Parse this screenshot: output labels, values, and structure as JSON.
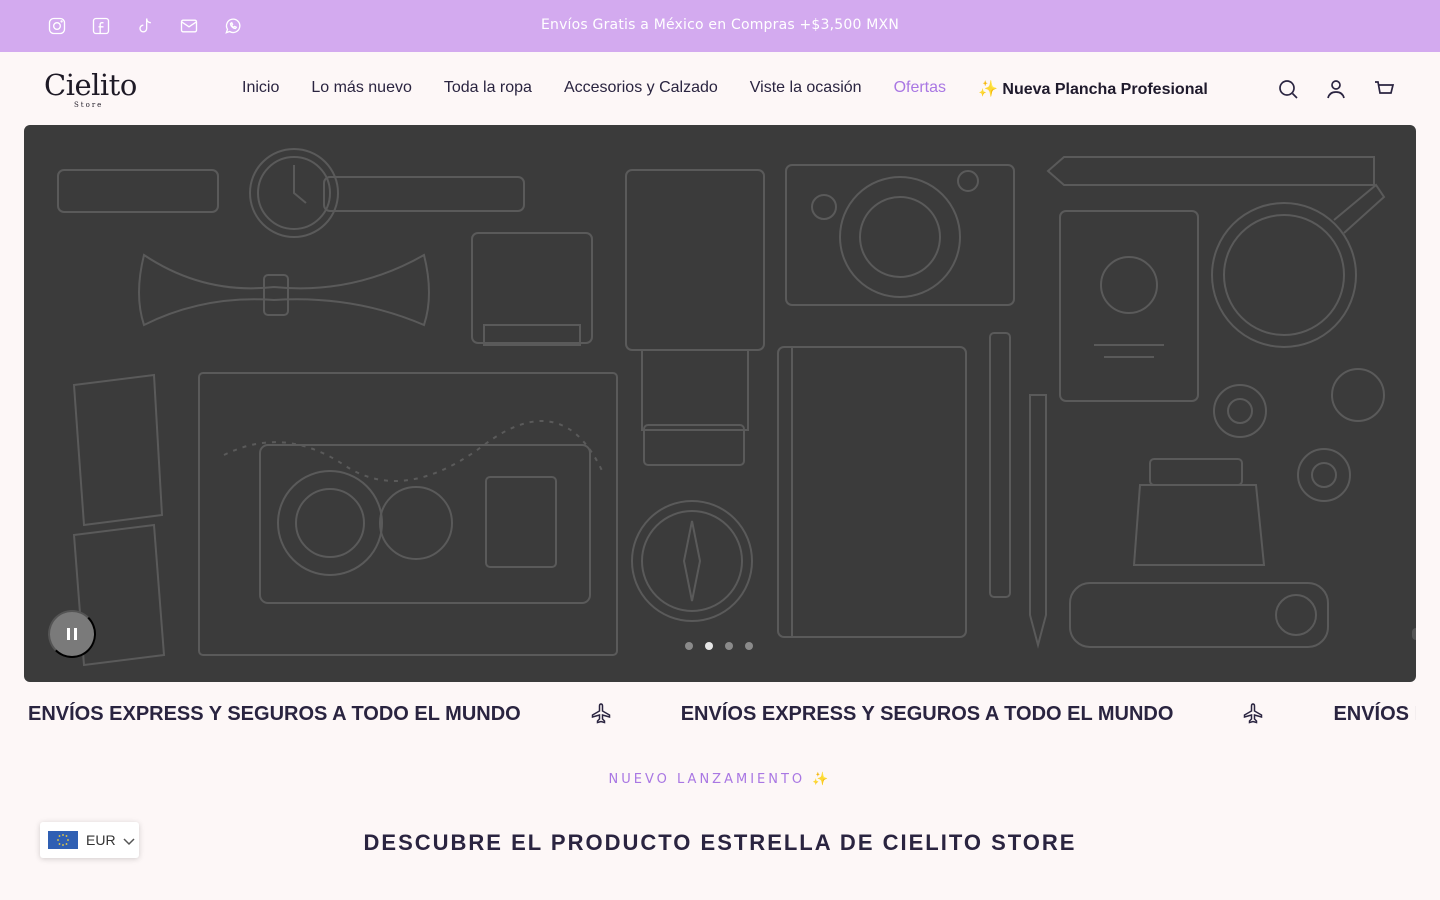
{
  "announcement_bar": {
    "background": "#d3aaef",
    "text": "Envíos Gratis a México en Compras +$3,500 MXN",
    "social_icons": [
      "instagram-icon",
      "facebook-icon",
      "tiktok-icon",
      "email-icon",
      "whatsapp-icon"
    ]
  },
  "header": {
    "logo_text": "Cielito",
    "logo_subtext": "Store",
    "nav": [
      {
        "label": "Inicio"
      },
      {
        "label": "Lo más nuevo"
      },
      {
        "label": "Toda la ropa"
      },
      {
        "label": "Accesorios y Calzado"
      },
      {
        "label": "Viste la ocasión"
      },
      {
        "label": "Ofertas",
        "color": "#a977e3"
      },
      {
        "label": "✨ Nueva Plancha Profesional"
      }
    ],
    "icons": [
      "search-icon",
      "account-icon",
      "cart-icon"
    ]
  },
  "hero": {
    "background": "#3b3b3b",
    "slide_count": 4,
    "active_slide": 2,
    "pause_icon": "pause-icon"
  },
  "marquee": {
    "text": "ENVÍOS EXPRESS Y SEGUROS A TODO EL MUNDO",
    "icon": "airplane-icon"
  },
  "featured": {
    "eyebrow": "NUEVO LANZAMIENTO ✨",
    "title": "DESCUBRE EL PRODUCTO ESTRELLA DE CIELITO STORE"
  },
  "currency_selector": {
    "code": "EUR",
    "flag": "eu-flag-icon"
  },
  "colors": {
    "accent": "#a977e3",
    "text": "#2a2440",
    "page_bg": "#fdf7f7"
  }
}
